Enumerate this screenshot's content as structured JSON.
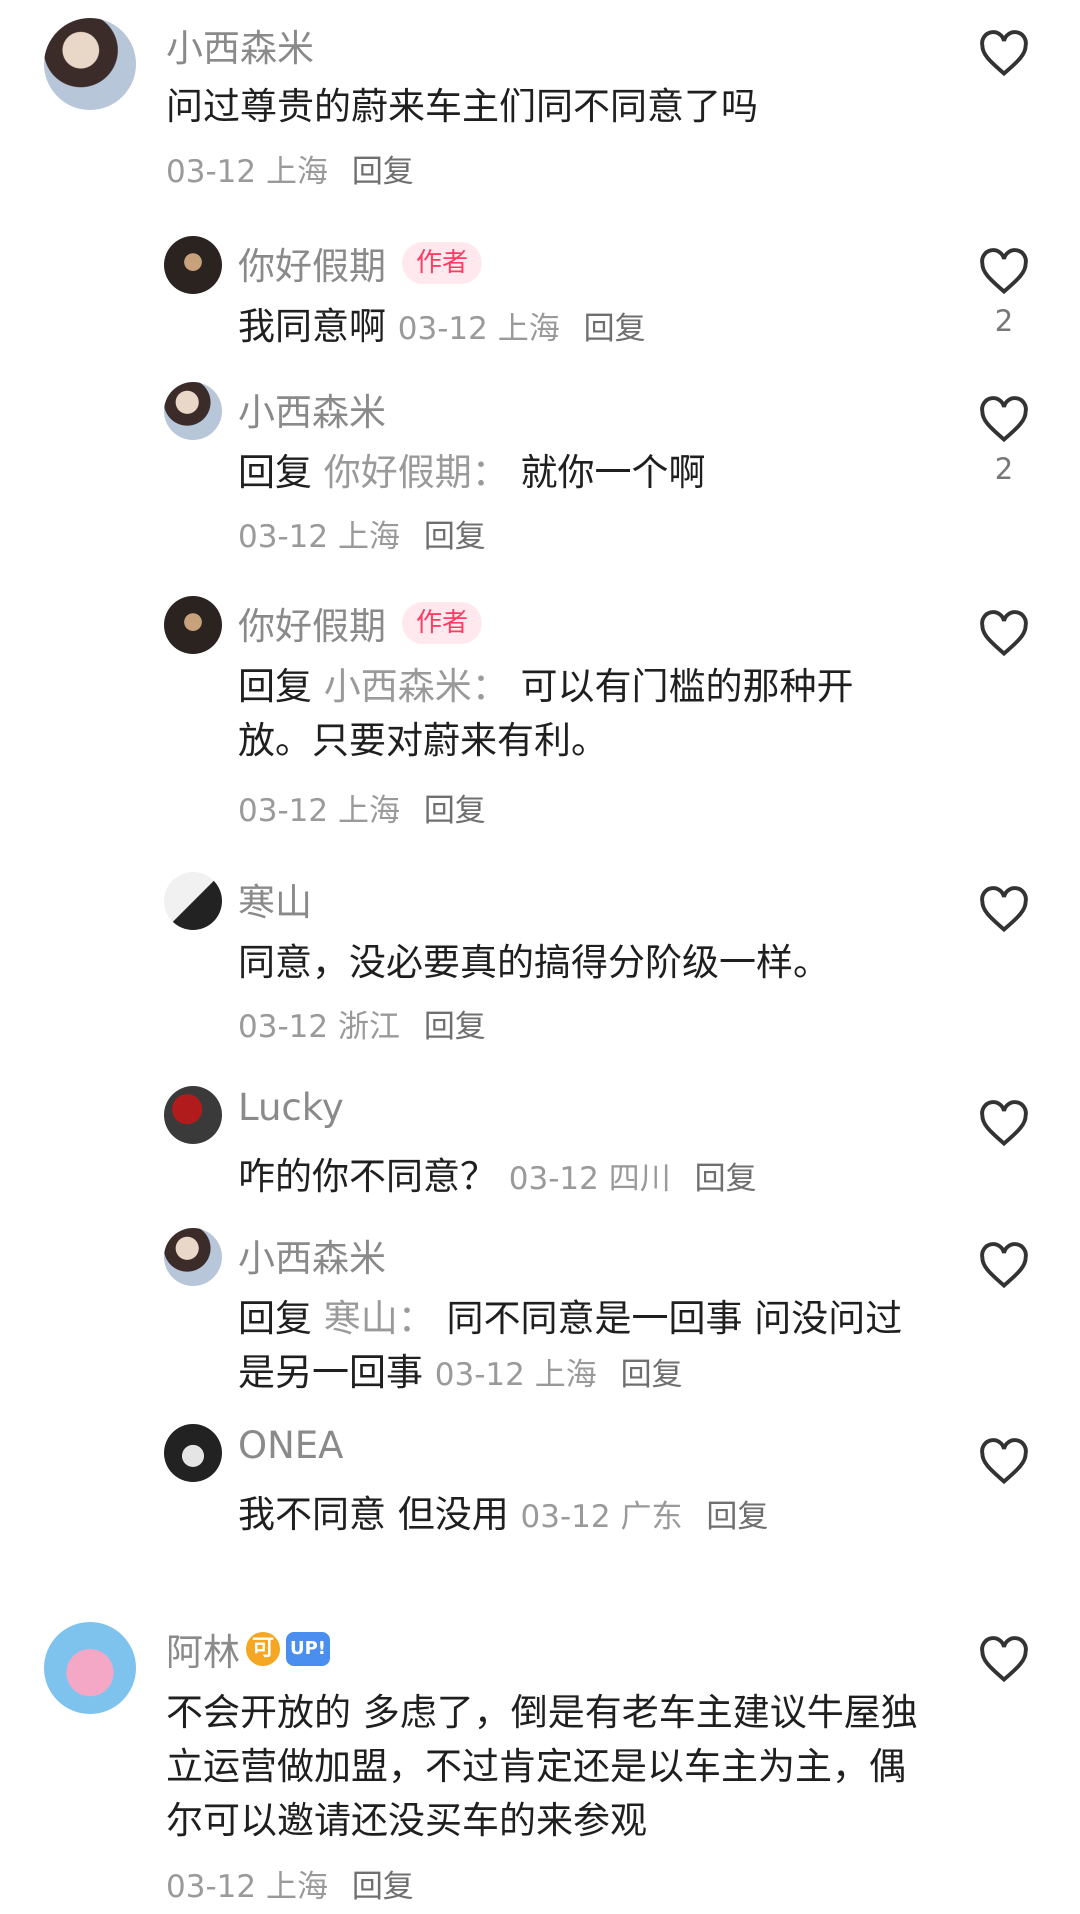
{
  "comments": [
    {
      "name": "小西森米",
      "text": "问过尊贵的蔚来车主们同不同意了吗",
      "date": "03-12",
      "location": "上海",
      "reply": "回复"
    },
    {
      "name": "你好假期",
      "badge": "作者",
      "text": "我同意啊",
      "date": "03-12",
      "location": "上海",
      "reply": "回复",
      "likes": "2"
    },
    {
      "name": "小西森米",
      "reply_prefix": "回复",
      "reply_to": "你好假期：",
      "text": "就你一个啊",
      "date": "03-12",
      "location": "上海",
      "reply": "回复",
      "likes": "2"
    },
    {
      "name": "你好假期",
      "badge": "作者",
      "reply_prefix": "回复",
      "reply_to": "小西森米：",
      "text": "可以有门槛的那种开放。只要对蔚来有利。",
      "date": "03-12",
      "location": "上海",
      "reply": "回复"
    },
    {
      "name": "寒山",
      "text": "同意，没必要真的搞得分阶级一样。",
      "date": "03-12",
      "location": "浙江",
      "reply": "回复"
    },
    {
      "name": "Lucky",
      "text": "咋的你不同意？",
      "date": "03-12",
      "location": "四川",
      "reply": "回复"
    },
    {
      "name": "小西森米",
      "reply_prefix": "回复",
      "reply_to": "寒山：",
      "text": "同不同意是一回事 问没问过是另一回事",
      "date": "03-12",
      "location": "上海",
      "reply": "回复"
    },
    {
      "name": "ONEA",
      "text": "我不同意 但没用",
      "date": "03-12",
      "location": "广东",
      "reply": "回复"
    },
    {
      "name": "阿林",
      "badge_icons": [
        "可",
        "UP!"
      ],
      "text": "不会开放的 多虑了，倒是有老车主建议牛屋独立运营做加盟，不过肯定还是以车主为主，偶尔可以邀请还没买车的来参观",
      "date": "03-12",
      "location": "上海",
      "reply": "回复"
    }
  ],
  "icons": {
    "like": "heart-outline-icon"
  },
  "colors": {
    "author_badge_bg": "#ffe9ee",
    "author_badge_text": "#ff3d63",
    "meta": "#9a9a9a"
  }
}
